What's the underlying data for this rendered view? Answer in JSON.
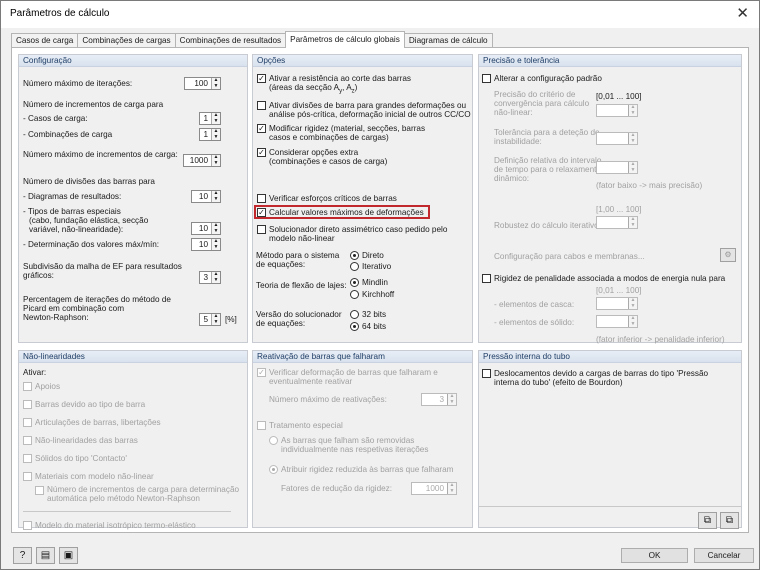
{
  "window": {
    "title": "Parâmetros de cálculo",
    "close": "✕"
  },
  "tabs": [
    "Casos de carga",
    "Combinações de cargas",
    "Combinações de resultados",
    "Parâmetros de cálculo globais",
    "Diagramas de cálculo"
  ],
  "config": {
    "header": "Configuração",
    "max_iter_label": "Número máximo de iterações:",
    "max_iter": "100",
    "incr_title": "Número de incrementos de carga para",
    "lc_label": "- Casos de carga:",
    "lc": "1",
    "co_label": "- Combinações de carga",
    "co": "1",
    "max_incr_label": "Número máximo de incrementos de carga:",
    "max_incr": "1000",
    "div_title": "Número de divisões das barras para",
    "diag_label": "- Diagramas de resultados:",
    "diag": "10",
    "special_l1": "- Tipos de barras especiais",
    "special_l2": "(cabo, fundação elástica, secção",
    "special_l3": "variável, não-linearidade):",
    "special": "10",
    "maxmin_label": "- Determinação dos valores máx/mín:",
    "maxmin": "10",
    "fe_l1": "Subdivisão da malha de EF para resultados",
    "fe_l2": "gráficos:",
    "fe": "3",
    "picard_l1": "Percentagem de iterações do método de",
    "picard_l2": "Picard em combinação com",
    "picard_l3": "Newton-Raphson:",
    "picard": "5",
    "picard_unit": "[%]"
  },
  "options": {
    "header": "Opções",
    "o1_l1": "Ativar a resistência ao corte das barras",
    "o1_l2": "(áreas da secção A",
    "o1_sub1": "y",
    "o1_mid": ", A",
    "o1_sub2": "z",
    "o1_end": ")",
    "o2_l1": "Ativar divisões de barra para grandes deformações ou",
    "o2_l2": "análise pós-crítica, deformação inicial de outros CC/CO",
    "o3_l1": "Modificar rigidez (material, secções, barras",
    "o3_l2": "casos e combinações de cargas)",
    "o4_l1": "Considerar opções extra",
    "o4_l2": "(combinações e casos de carga)",
    "o5": "Verificar esforços críticos de barras",
    "o6": "Calcular valores máximos de deformações",
    "o7_l1": "Solucionador direto assimétrico caso pedido pelo",
    "o7_l2": "modelo não-linear",
    "method_l1": "Método para o sistema",
    "method_l2": "de equações:",
    "method_a": "Direto",
    "method_b": "Iterativo",
    "plate_label": "Teoria de flexão de lajes:",
    "plate_a": "Mindlin",
    "plate_b": "Kirchhoff",
    "solver_l1": "Versão do solucionador",
    "solver_l2": "de equações:",
    "solver_a": "32 bits",
    "solver_b": "64 bits"
  },
  "precision": {
    "header": "Precisão e tolerância",
    "change": "Alterar a configuração padrão",
    "range1": "[0,01 ... 100]",
    "conv_l1": "Precisão do critério de",
    "conv_l2": "convergência para cálculo",
    "conv_l3": "não-linear:",
    "tol_l1": "Tolerância para a deteção de",
    "tol_l2": "instabilidade:",
    "def_l1": "Definição relativa do intervalo",
    "def_l2": "de tempo para o relaxamento",
    "def_l3": "dinâmico:",
    "hint1": "(fator baixo -> mais precisão)",
    "range2": "[1,00 ... 100]",
    "robust": "Robustez do cálculo iterativo:",
    "cables": "Configuração para cabos e membranas...",
    "penalty": "Rigidez de penalidade associada a modos de energia nula para",
    "range3": "[0,01 ... 100]",
    "shell": "- elementos de casca:",
    "solid": "- elementos de sólido:",
    "hint2": "(fator inferior -> penalidade inferior)"
  },
  "nonlin": {
    "header": "Não-linearidades",
    "activate": "Ativar:",
    "items": [
      "Apoios",
      "Barras devido ao tipo de barra",
      "Articulações de barras, libertações",
      "Não-linearidades das barras",
      "Sólidos do tipo 'Contacto'",
      "Materiais com modelo não-linear"
    ],
    "sub_l1": "Número de incrementos de carga para determinação",
    "sub_l2": "automática pelo método Newton-Raphson",
    "thermo": "Modelo do material isotrópico termo-elástico"
  },
  "reactivation": {
    "header": "Reativação de barras que falharam",
    "verify_l1": "Verificar deformação de barras que falharam e",
    "verify_l2": "eventualmente reativar",
    "max_label": "Número máximo de reativações:",
    "max": "3",
    "special": "Tratamento especial",
    "r1_l1": "As barras que falham são removidas",
    "r1_l2": "individualmente nas respetivas iterações",
    "r2": "Atribuir rigidez reduzida às barras que falharam",
    "factor_label": "Fatores de redução da rigidez:",
    "factor": "1000"
  },
  "pressure": {
    "header": "Pressão interna do tubo",
    "l1": "Deslocamentos devido a cargas de barras do tipo 'Pressão",
    "l2": "interna do tubo' (efeito de Bourdon)"
  },
  "footer": {
    "ok": "OK",
    "cancel": "Cancelar"
  }
}
